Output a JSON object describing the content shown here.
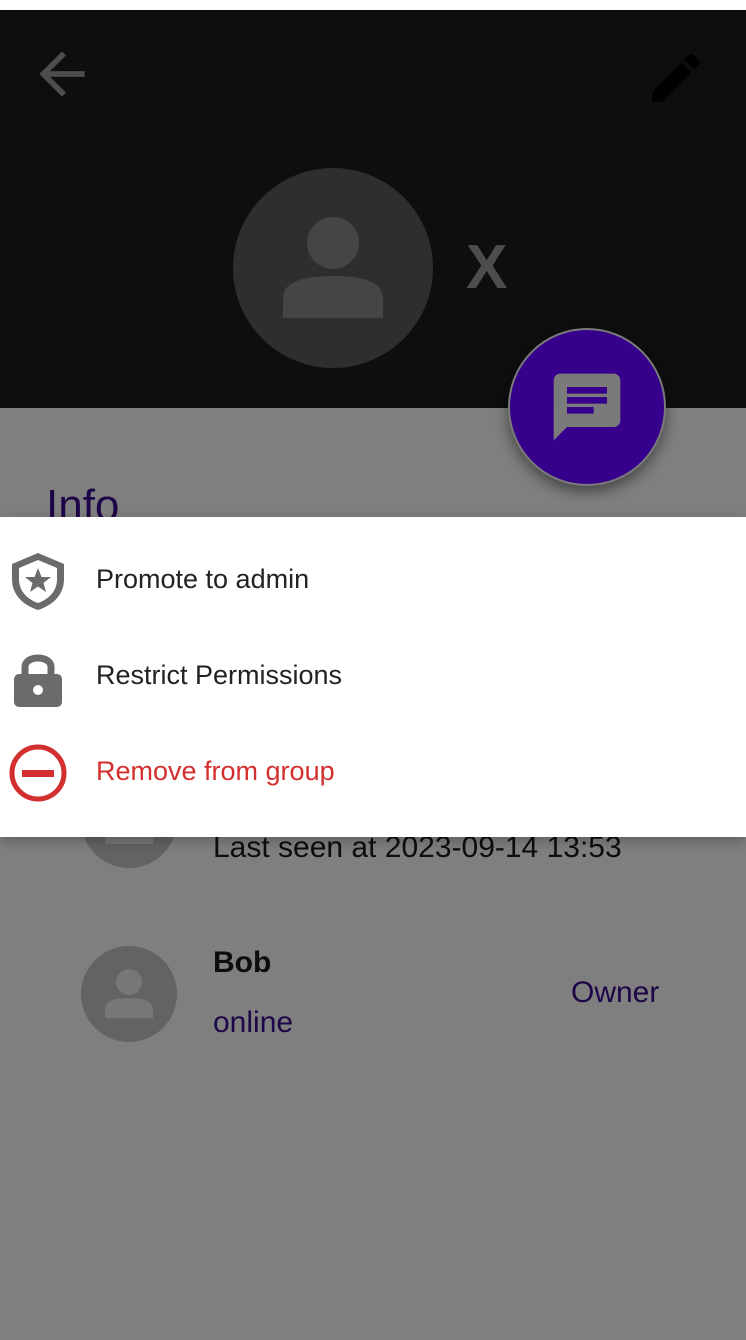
{
  "header": {
    "group_name": "X",
    "icons": {
      "back": "arrow-back-icon",
      "edit": "pencil-icon",
      "avatar": "person-icon",
      "chat": "chat-icon"
    }
  },
  "info": {
    "heading": "Info"
  },
  "members": [
    {
      "name": "",
      "status": "Last seen at 2023-09-14 13:53",
      "role": ""
    },
    {
      "name": "Bob",
      "status": "online",
      "role": "Owner"
    }
  ],
  "menu": {
    "items": [
      {
        "label": "Promote to admin",
        "icon": "shield-star-icon"
      },
      {
        "label": "Restrict Permissions",
        "icon": "lock-icon"
      },
      {
        "label": "Remove from group",
        "icon": "remove-circle-icon"
      }
    ]
  },
  "colors": {
    "appbar": "#1c1c1c",
    "accent": "#36008c",
    "heading": "#3a0a8f",
    "danger": "#d32f2f",
    "icon_gray": "#6b6b6b"
  }
}
